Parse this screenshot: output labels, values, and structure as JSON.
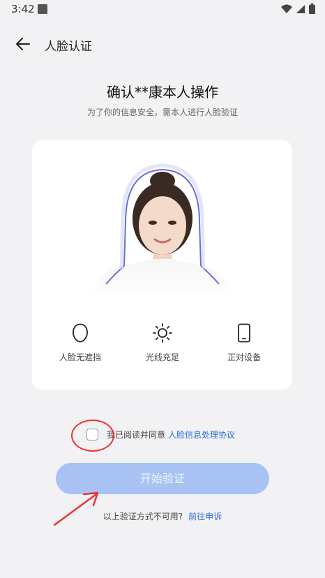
{
  "status_bar": {
    "time": "3:42"
  },
  "app_bar": {
    "title": "人脸认证"
  },
  "heading": "确认**康本人操作",
  "subheading": "为了你的信息安全，需本人进行人脸验证",
  "tips": [
    {
      "label": "人脸无遮挡",
      "icon": "face-outline-icon"
    },
    {
      "label": "光线充足",
      "icon": "sun-icon"
    },
    {
      "label": "正对设备",
      "icon": "phone-icon"
    }
  ],
  "agreement": {
    "text": "我已阅读并同意",
    "link": "人脸信息处理协议",
    "checked": false
  },
  "verify_button": {
    "label": "开始验证",
    "enabled": false
  },
  "footer": {
    "text": "以上验证方式不可用?",
    "link": "前往申诉"
  },
  "colors": {
    "accent": "#2d6bd8",
    "button_disabled": "#a8c3f3",
    "annotation": "#ee3333"
  }
}
